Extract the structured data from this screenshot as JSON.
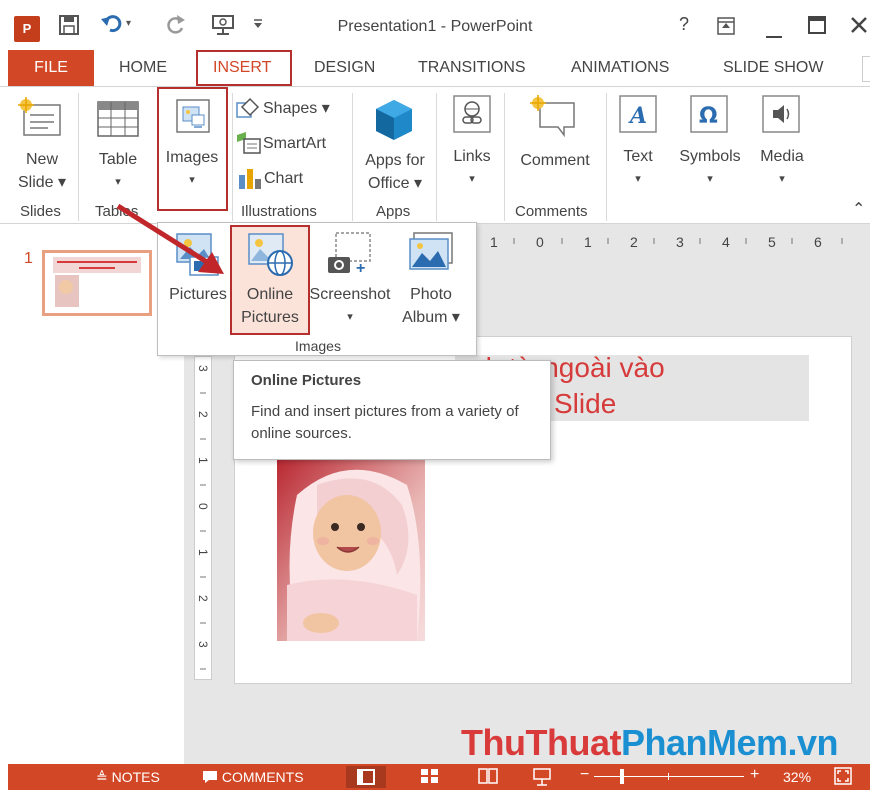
{
  "window": {
    "title": "Presentation1 - PowerPoint",
    "help": "?",
    "app_logo": "P"
  },
  "tabs": {
    "file": "FILE",
    "home": "HOME",
    "insert": "INSERT",
    "design": "DESIGN",
    "transitions": "TRANSITIONS",
    "animations": "ANIMATIONS",
    "slideshow": "SLIDE SHOW"
  },
  "ribbon": {
    "new_slide": [
      "New",
      "Slide ▾"
    ],
    "table": "Table",
    "images": "Images",
    "shapes": "Shapes ▾",
    "smartart": "SmartArt",
    "chart": "Chart",
    "apps_for_office": [
      "Apps for",
      "Office ▾"
    ],
    "links": "Links",
    "comment": "Comment",
    "text": "Text",
    "symbols": "Symbols",
    "media": "Media",
    "groups": {
      "slides": "Slides",
      "tables": "Tables",
      "illustrations": "Illustrations",
      "apps": "Apps",
      "comments": "Comments"
    }
  },
  "images_dropdown": {
    "pictures": "Pictures",
    "online_pictures": [
      "Online",
      "Pictures"
    ],
    "screenshot": "Screenshot",
    "photo_album": [
      "Photo",
      "Album ▾"
    ],
    "group": "Images"
  },
  "thumbnails": {
    "slide_number": "1"
  },
  "ruler": {
    "ticks": [
      "1",
      "0",
      "1",
      "2",
      "3",
      "4",
      "5",
      "6"
    ],
    "vertical": [
      "3",
      "2",
      "1",
      "0",
      "1",
      "2",
      "3"
    ]
  },
  "slide": {
    "title_line1": "nh từ ngoài vào",
    "title_line2": "Slide"
  },
  "tooltip": {
    "title": "Online Pictures",
    "body": "Find and insert pictures from a variety of online sources."
  },
  "watermark": {
    "part1": "ThuThuat",
    "part2": "PhanMem",
    "part3": ".vn"
  },
  "statusbar": {
    "notes": "NOTES",
    "comments": "COMMENTS",
    "zoom": "32%"
  },
  "colors": {
    "accent": "#d24726",
    "highlight_box": "#b52f2f",
    "watermark_red": "#d93a3a",
    "watermark_blue": "#1a8fd1"
  }
}
